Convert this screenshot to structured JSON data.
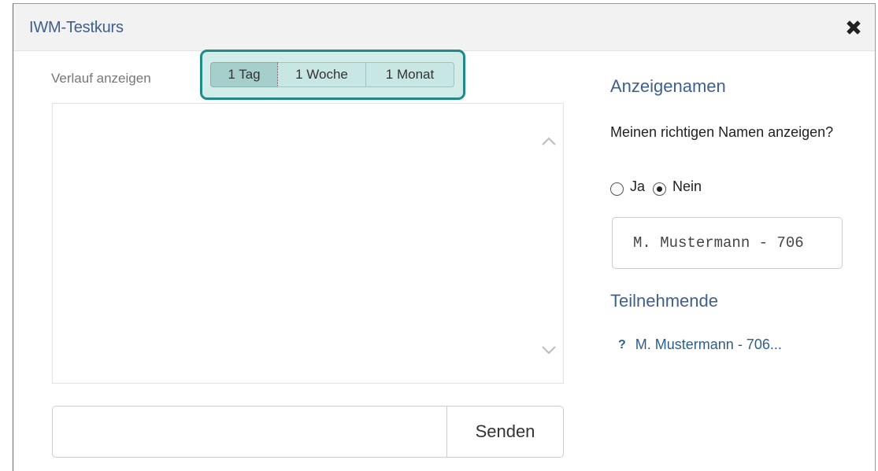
{
  "dialog": {
    "title": "IWM-Testkurs",
    "close_icon": "close-x-icon"
  },
  "history": {
    "label": "Verlauf anzeigen",
    "tabs": [
      {
        "label": "1 Tag",
        "active": true
      },
      {
        "label": "1 Woche",
        "active": false
      },
      {
        "label": "1 Monat",
        "active": false
      }
    ]
  },
  "chat": {
    "scroll_up_icon": "chevron-up-icon",
    "scroll_down_icon": "chevron-down-icon",
    "message_value": "",
    "send_label": "Senden"
  },
  "display_name": {
    "heading": "Anzeigenamen",
    "question": "Meinen richtigen Namen anzeigen?",
    "options": [
      {
        "label": "Ja",
        "checked": false
      },
      {
        "label": "Nein",
        "checked": true
      }
    ],
    "name_value": "M. Mustermann - 706"
  },
  "participants": {
    "heading": "Teilnehmende",
    "items": [
      {
        "icon": "?",
        "name": "M. Mustermann - 706..."
      }
    ]
  },
  "colors": {
    "accent": "#3f5f8c",
    "tab_highlight_border": "#1f8a87",
    "tab_highlight_fill": "#d2ecea",
    "titlebar_bg": "#f2f2f2"
  }
}
